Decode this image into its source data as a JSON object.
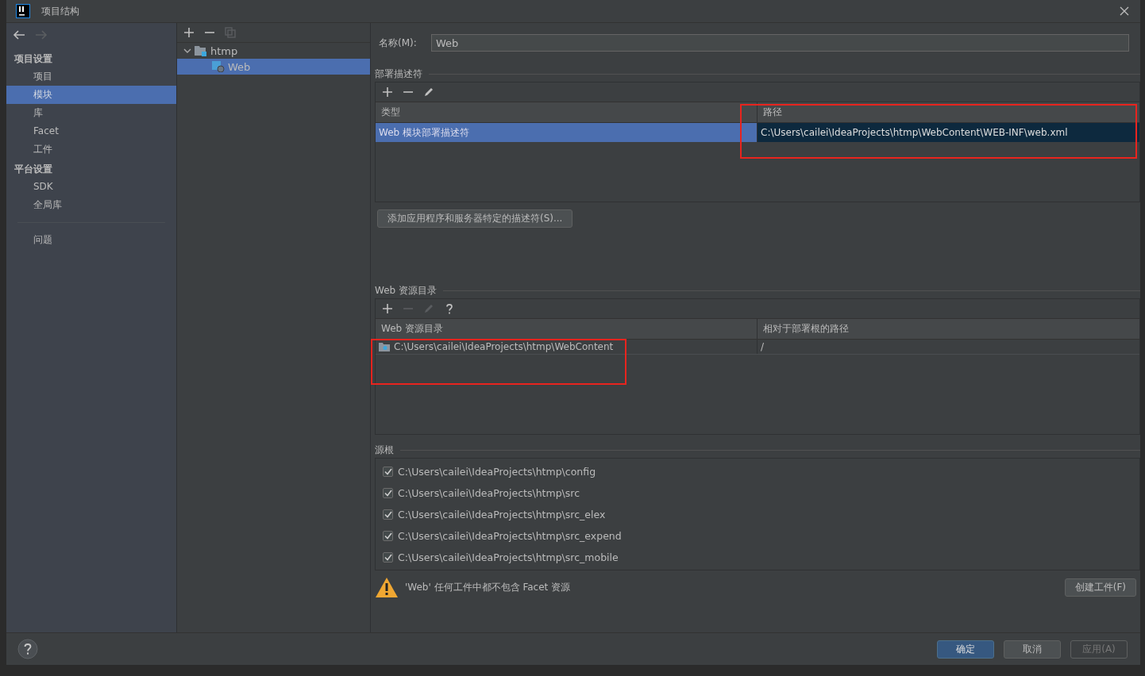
{
  "window": {
    "title": "项目结构"
  },
  "nav": [
    {
      "kind": "back",
      "disabled": false
    },
    {
      "kind": "forward",
      "disabled": true
    }
  ],
  "sidebar": {
    "sections": [
      {
        "heading": "项目设置",
        "items": [
          {
            "label": "项目",
            "selected": false
          },
          {
            "label": "模块",
            "selected": true
          },
          {
            "label": "库",
            "selected": false
          },
          {
            "label": "Facet",
            "selected": false
          },
          {
            "label": "工件",
            "selected": false
          }
        ]
      },
      {
        "heading": "平台设置",
        "items": [
          {
            "label": "SDK",
            "selected": false
          },
          {
            "label": "全局库",
            "selected": false
          }
        ]
      }
    ],
    "extra_items": [
      {
        "label": "问题",
        "selected": false
      }
    ]
  },
  "tree": {
    "toolbar": [
      {
        "kind": "add",
        "disabled": false
      },
      {
        "kind": "remove",
        "disabled": false
      },
      {
        "kind": "copy",
        "disabled": true
      }
    ],
    "nodes": [
      {
        "label": "htmp",
        "expanded": true,
        "selected": false,
        "children": [
          {
            "label": "Web",
            "selected": true
          }
        ]
      }
    ]
  },
  "name_field": {
    "label": "名称(M):",
    "value": "Web"
  },
  "deployment": {
    "title": "部署描述符",
    "toolbar": [
      {
        "kind": "add",
        "disabled": false
      },
      {
        "kind": "remove",
        "disabled": false
      },
      {
        "kind": "edit",
        "disabled": false
      }
    ],
    "columns": [
      "类型",
      "路径"
    ],
    "rows": [
      {
        "cells": [
          "Web 模块部署描述符",
          "C:\\Users\\cailei\\IdeaProjects\\htmp\\WebContent\\WEB-INF\\web.xml"
        ],
        "selected": true
      }
    ],
    "add_button": "添加应用程序和服务器特定的描述符(S)..."
  },
  "web_resources": {
    "title": "Web 资源目录",
    "toolbar": [
      {
        "kind": "add",
        "disabled": false
      },
      {
        "kind": "remove",
        "disabled": true
      },
      {
        "kind": "edit",
        "disabled": true
      },
      {
        "kind": "help",
        "disabled": false
      }
    ],
    "columns": [
      "Web 资源目录",
      "相对于部署根的路径"
    ],
    "rows": [
      {
        "cells": [
          "C:\\Users\\cailei\\IdeaProjects\\htmp\\WebContent",
          "/"
        ],
        "selected": false
      }
    ]
  },
  "source_roots": {
    "title": "源根",
    "items": [
      {
        "path": "C:\\Users\\cailei\\IdeaProjects\\htmp\\config",
        "checked": true
      },
      {
        "path": "C:\\Users\\cailei\\IdeaProjects\\htmp\\src",
        "checked": true
      },
      {
        "path": "C:\\Users\\cailei\\IdeaProjects\\htmp\\src_elex",
        "checked": true
      },
      {
        "path": "C:\\Users\\cailei\\IdeaProjects\\htmp\\src_expend",
        "checked": true
      },
      {
        "path": "C:\\Users\\cailei\\IdeaProjects\\htmp\\src_mobile",
        "checked": true
      }
    ]
  },
  "warning": {
    "text": "'Web' 任何工件中都不包含 Facet 资源",
    "button": "创建工件(F)"
  },
  "footer": {
    "buttons": [
      {
        "label": "确定",
        "kind": "primary"
      },
      {
        "label": "取消",
        "kind": "normal"
      },
      {
        "label": "应用(A)",
        "kind": "disabled"
      }
    ]
  }
}
